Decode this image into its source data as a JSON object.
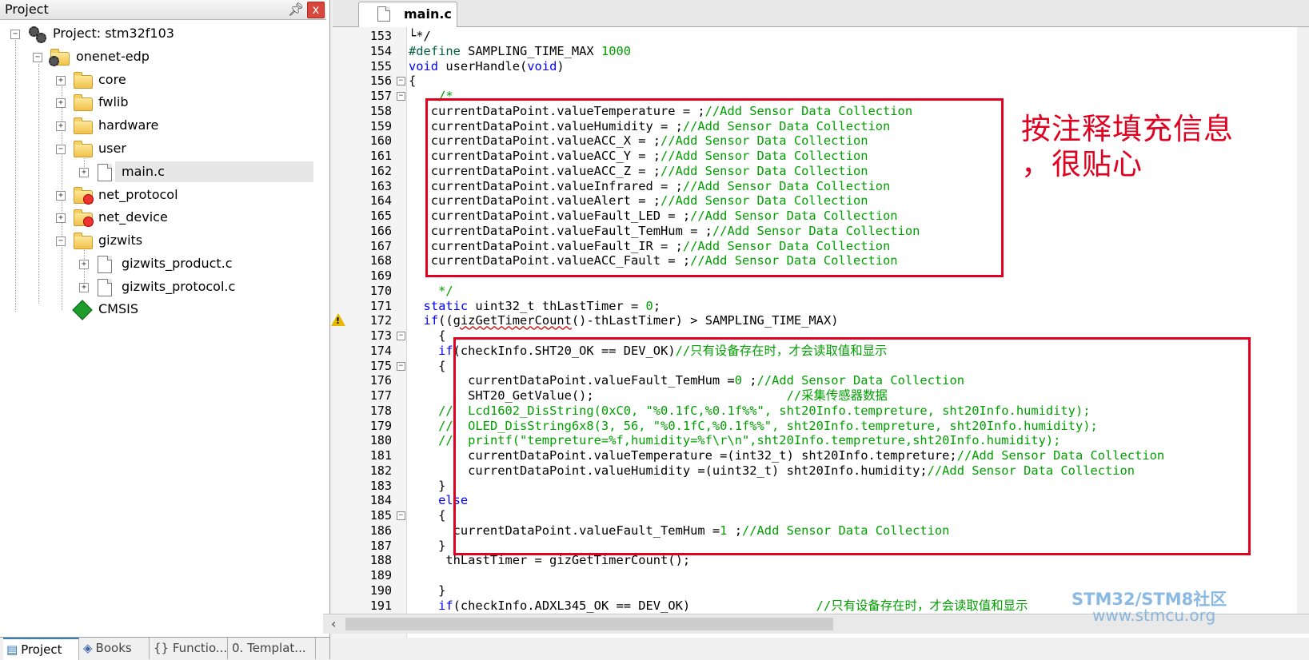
{
  "project_panel": {
    "title": "Project",
    "pin_icon": "pin-icon",
    "close_label": "x",
    "tree": {
      "root": "Project: stm32f103",
      "target": "onenet-edp",
      "groups": [
        "core",
        "fwlib",
        "hardware",
        "user",
        "net_protocol",
        "net_device",
        "gizwits"
      ],
      "user_files": [
        "main.c"
      ],
      "gizwits_files": [
        "gizwits_product.c",
        "gizwits_protocol.c"
      ],
      "cmsis": "CMSIS"
    },
    "bottom_tabs": [
      "Project",
      "Books",
      "{} Functio...",
      "0. Templat..."
    ]
  },
  "editor": {
    "tab_label": "main.c",
    "lines": [
      {
        "n": "153",
        "t": "└*/"
      },
      {
        "n": "154",
        "t": "#define SAMPLING_TIME_MAX 1000"
      },
      {
        "n": "155",
        "t": "void userHandle(void)"
      },
      {
        "n": "156",
        "t": "{"
      },
      {
        "n": "157",
        "t": "    /*"
      },
      {
        "n": "158",
        "t": "   currentDataPoint.valueTemperature = ;//Add Sensor Data Collection"
      },
      {
        "n": "159",
        "t": "   currentDataPoint.valueHumidity = ;//Add Sensor Data Collection"
      },
      {
        "n": "160",
        "t": "   currentDataPoint.valueACC_X = ;//Add Sensor Data Collection"
      },
      {
        "n": "161",
        "t": "   currentDataPoint.valueACC_Y = ;//Add Sensor Data Collection"
      },
      {
        "n": "162",
        "t": "   currentDataPoint.valueACC_Z = ;//Add Sensor Data Collection"
      },
      {
        "n": "163",
        "t": "   currentDataPoint.valueInfrared = ;//Add Sensor Data Collection"
      },
      {
        "n": "164",
        "t": "   currentDataPoint.valueAlert = ;//Add Sensor Data Collection"
      },
      {
        "n": "165",
        "t": "   currentDataPoint.valueFault_LED = ;//Add Sensor Data Collection"
      },
      {
        "n": "166",
        "t": "   currentDataPoint.valueFault_TemHum = ;//Add Sensor Data Collection"
      },
      {
        "n": "167",
        "t": "   currentDataPoint.valueFault_IR = ;//Add Sensor Data Collection"
      },
      {
        "n": "168",
        "t": "   currentDataPoint.valueACC_Fault = ;//Add Sensor Data Collection"
      },
      {
        "n": "169",
        "t": ""
      },
      {
        "n": "170",
        "t": "    */"
      },
      {
        "n": "171",
        "t": "  static uint32_t thLastTimer = 0;"
      },
      {
        "n": "172",
        "t": "  if((gizGetTimerCount()-thLastTimer) > SAMPLING_TIME_MAX)"
      },
      {
        "n": "173",
        "t": "    {"
      },
      {
        "n": "174",
        "t": "    if(checkInfo.SHT20_OK == DEV_OK)//只有设备存在时，才会读取值和显示"
      },
      {
        "n": "175",
        "t": "    {"
      },
      {
        "n": "176",
        "t": "        currentDataPoint.valueFault_TemHum =0 ;//Add Sensor Data Collection"
      },
      {
        "n": "177",
        "t": "        SHT20_GetValue();                          //采集传感器数据"
      },
      {
        "n": "178",
        "t": "    //  Lcd1602_DisString(0xC0, \"%0.1fC,%0.1f%%\", sht20Info.tempreture, sht20Info.humidity);"
      },
      {
        "n": "179",
        "t": "    //  OLED_DisString6x8(3, 56, \"%0.1fC,%0.1f%%\", sht20Info.tempreture, sht20Info.humidity);"
      },
      {
        "n": "180",
        "t": "    //  printf(\"tempreture=%f,humidity=%f\\r\\n\",sht20Info.tempreture,sht20Info.humidity);"
      },
      {
        "n": "181",
        "t": "        currentDataPoint.valueTemperature =(int32_t) sht20Info.tempreture;//Add Sensor Data Collection"
      },
      {
        "n": "182",
        "t": "        currentDataPoint.valueHumidity =(uint32_t) sht20Info.humidity;//Add Sensor Data Collection"
      },
      {
        "n": "183",
        "t": "    }"
      },
      {
        "n": "184",
        "t": "    else"
      },
      {
        "n": "185",
        "t": "    {"
      },
      {
        "n": "186",
        "t": "      currentDataPoint.valueFault_TemHum =1 ;//Add Sensor Data Collection"
      },
      {
        "n": "187",
        "t": "    }"
      },
      {
        "n": "188",
        "t": "     thLastTimer = gizGetTimerCount();"
      },
      {
        "n": "189",
        "t": ""
      },
      {
        "n": "190",
        "t": "    }"
      },
      {
        "n": "191",
        "t": "    if(checkInfo.ADXL345_OK == DEV_OK)                 //只有设备存在时，才会读取值和显示"
      }
    ]
  },
  "annotation": {
    "line1": "按注释填充信息",
    "line2": "，很贴心"
  },
  "watermark": {
    "line1": "STM32/STM8社区",
    "line2": "www.stmcu.org"
  },
  "colors": {
    "keyword": "#0000ff",
    "comment": "#00a000",
    "highlight_box": "#e00020"
  }
}
